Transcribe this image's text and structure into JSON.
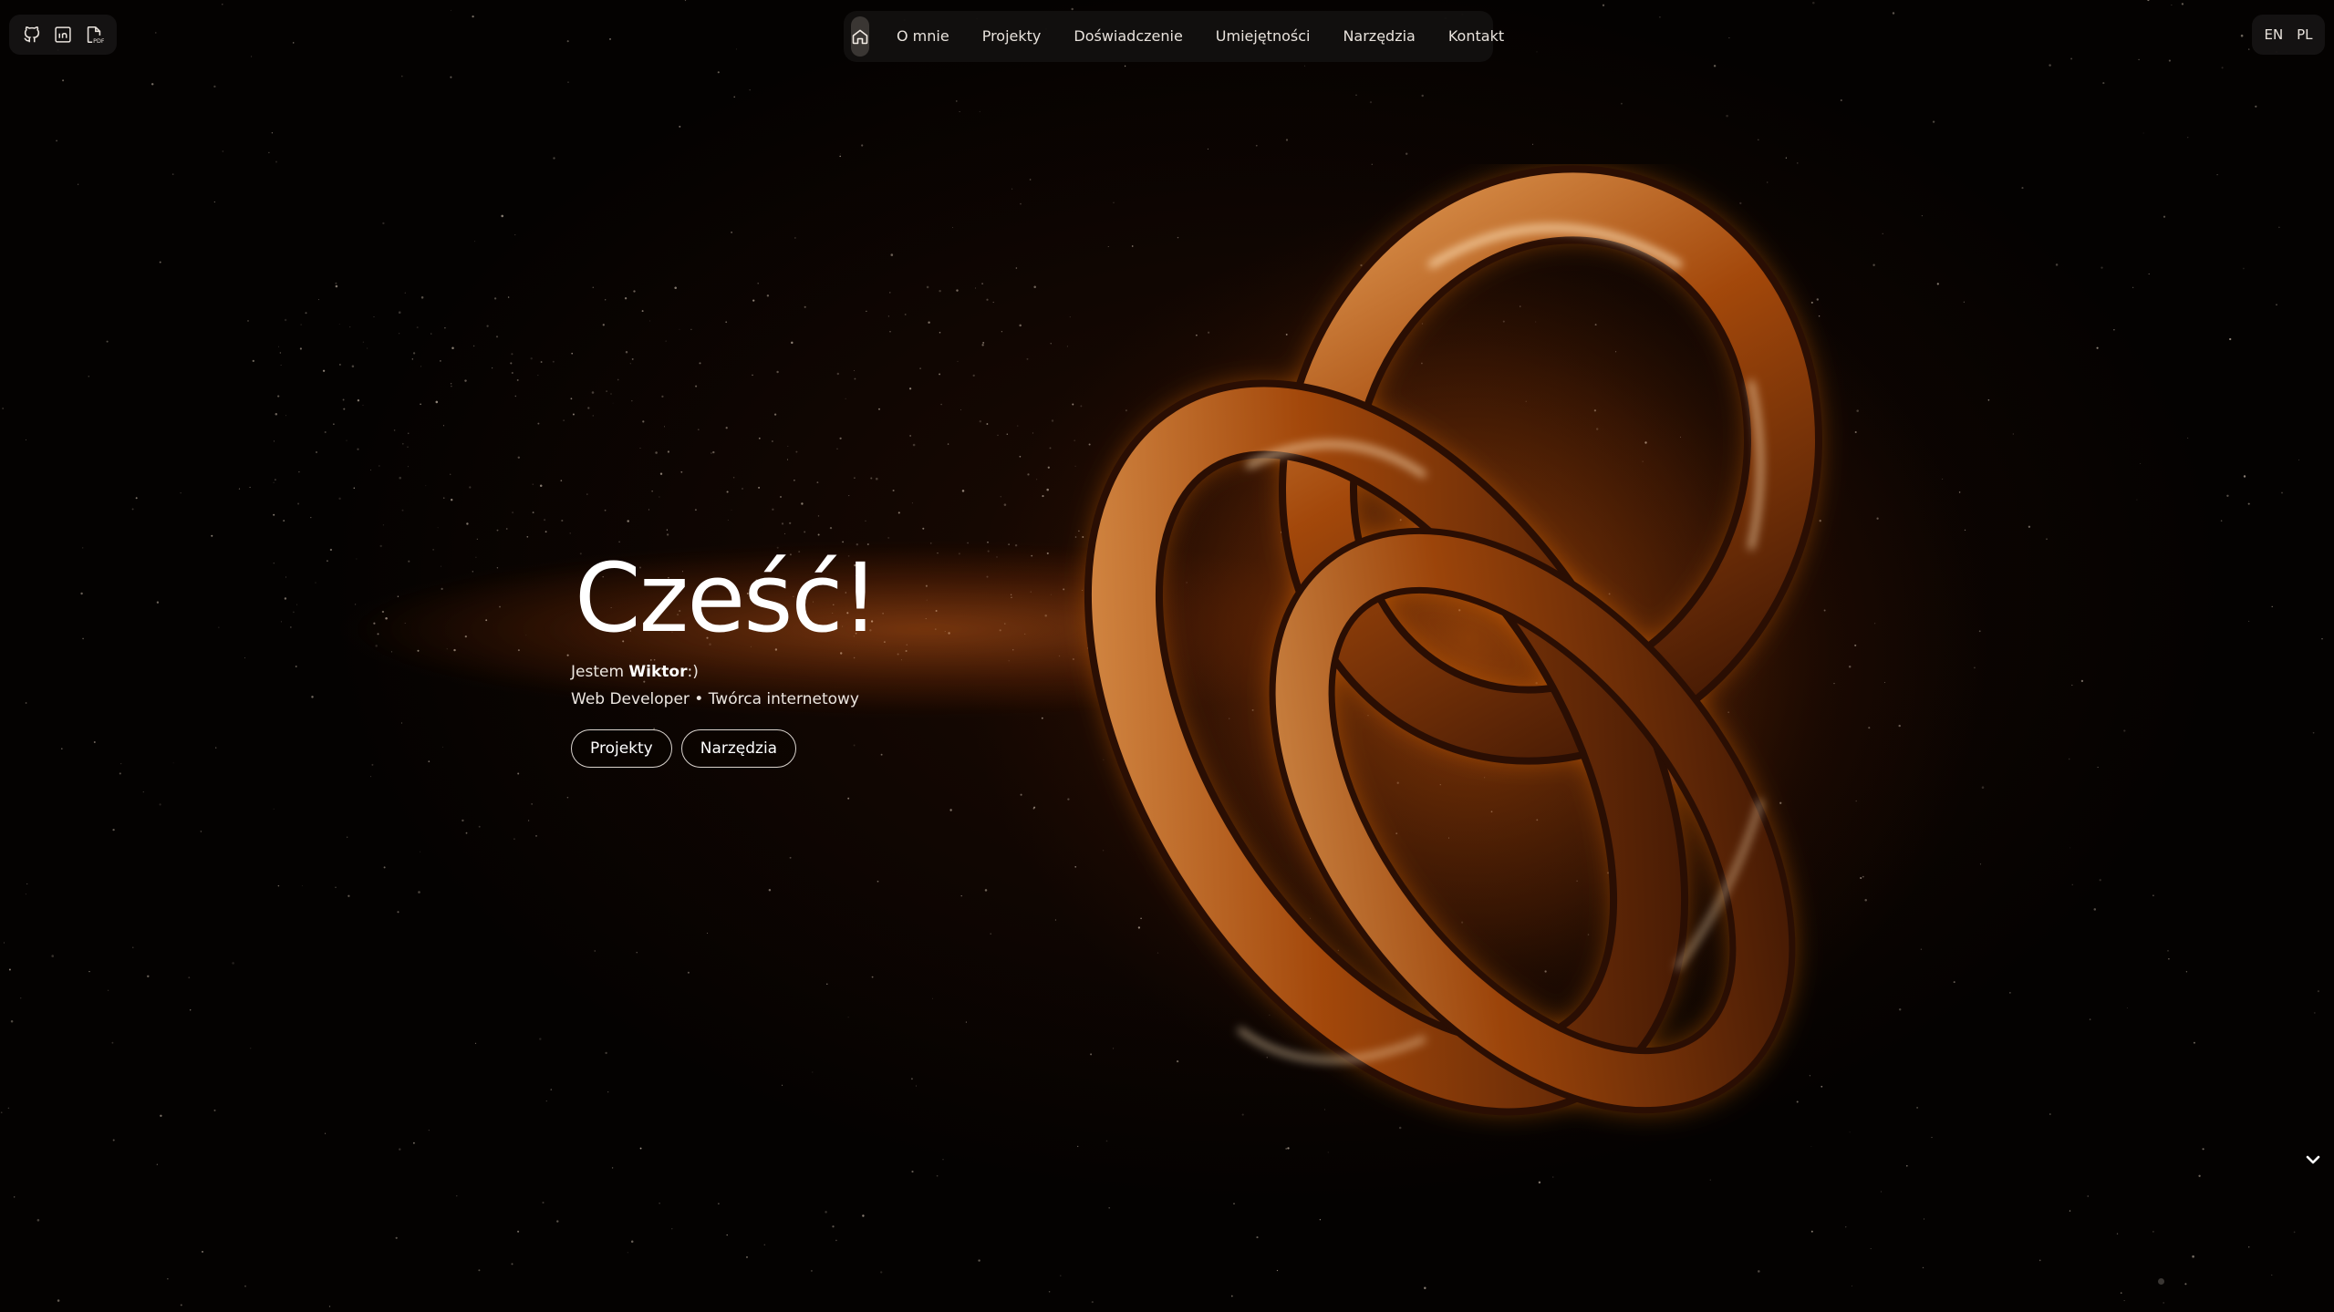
{
  "social": {
    "icons": [
      "github-icon",
      "linkedin-icon",
      "pdf-cv-icon"
    ]
  },
  "nav": {
    "home_icon": "home-icon",
    "items": [
      {
        "label": "O mnie"
      },
      {
        "label": "Projekty"
      },
      {
        "label": "Doświadczenie"
      },
      {
        "label": "Umiejętności"
      },
      {
        "label": "Narzędzia"
      },
      {
        "label": "Kontakt"
      }
    ]
  },
  "lang": {
    "en": "EN",
    "pl": "PL"
  },
  "hero": {
    "title": "Cześć!",
    "intro_prefix": "Jestem ",
    "name": "Wiktor",
    "intro_suffix": ":)",
    "role": "Web Developer • Twórca internetowy",
    "buttons": [
      {
        "label": "Projekty"
      },
      {
        "label": "Narzędzia"
      }
    ]
  },
  "scroll_icon": "chevron-down-icon",
  "colors": {
    "accent": "#ff8a1f",
    "background": "#040201"
  }
}
